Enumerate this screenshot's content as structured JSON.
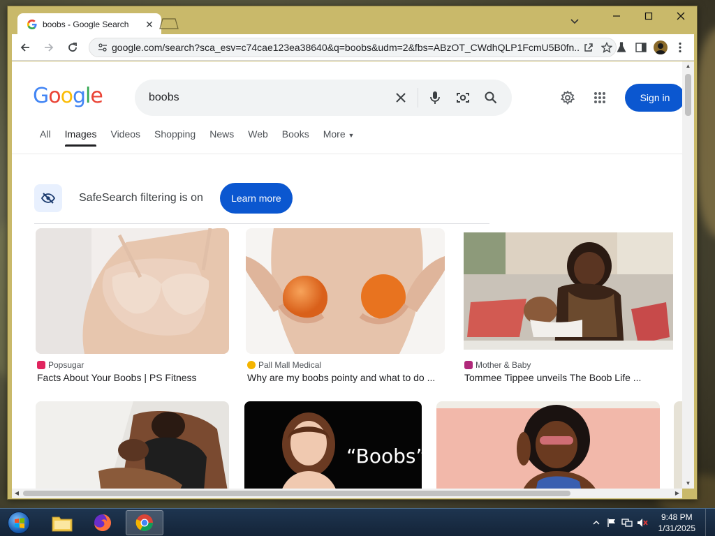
{
  "browser": {
    "tab_title": "boobs - Google Search",
    "url": "google.com/search?sca_esv=c74cae123ea38640&q=boobs&udm=2&fbs=ABzOT_CWdhQLP1FcmU5B0fn..."
  },
  "google": {
    "logo": [
      "G",
      "o",
      "o",
      "g",
      "l",
      "e"
    ],
    "query": "boobs",
    "sign_in": "Sign in",
    "tabs": [
      "All",
      "Images",
      "Videos",
      "Shopping",
      "News",
      "Web",
      "Books",
      "More"
    ],
    "active_tab": "Images"
  },
  "safesearch": {
    "text": "SafeSearch filtering is on",
    "button": "Learn more"
  },
  "results": [
    {
      "source": "Popsugar",
      "title": "Facts About Your Boobs | PS Fitness",
      "fav_color": "#e0245e"
    },
    {
      "source": "Pall Mall Medical",
      "title": "Why are my boobs pointy and what to do ...",
      "fav_color": "#f4b400"
    },
    {
      "source": "Mother & Baby",
      "title": "Tommee Tippee unveils The Boob Life ...",
      "fav_color": "#b0287a"
    },
    {
      "overlay_text": "“Boobs”?"
    }
  ],
  "taskbar": {
    "time": "9:48 PM",
    "date": "1/31/2025"
  }
}
